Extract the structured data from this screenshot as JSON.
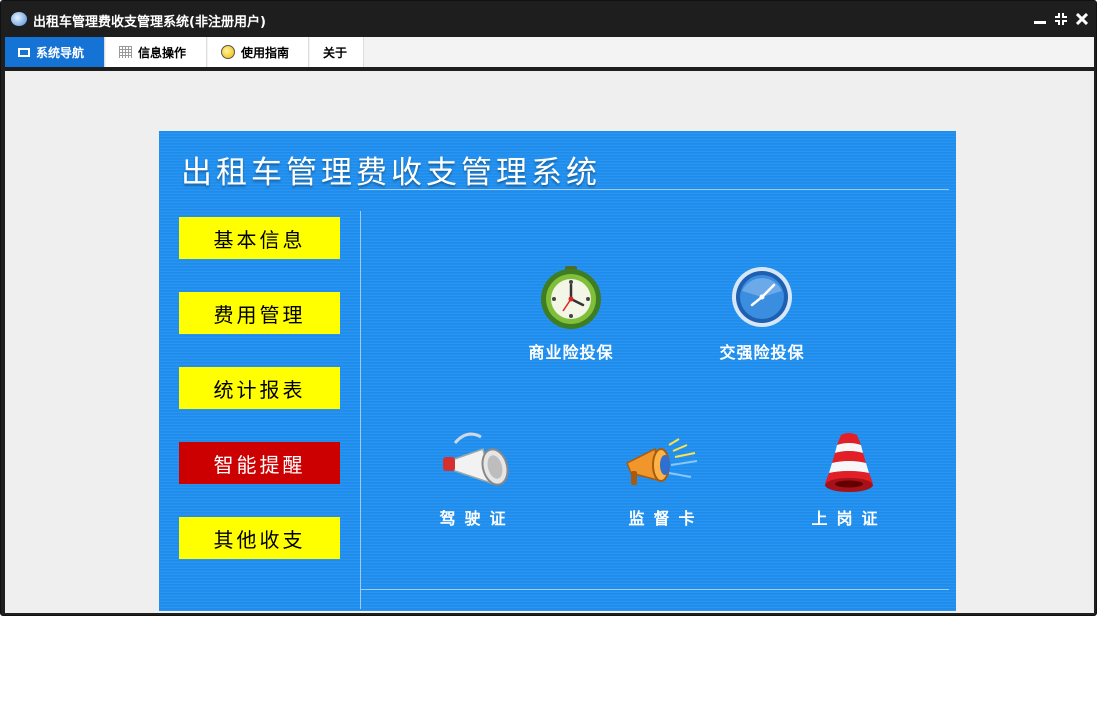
{
  "window": {
    "title": "出租车管理费收支管理系统(非注册用户)",
    "controls": {
      "minimize": "▁",
      "restore": "⇲",
      "close": "✕"
    }
  },
  "menu": {
    "tabs": [
      {
        "label": "系统导航",
        "icon": "monitor-icon",
        "active": true
      },
      {
        "label": "信息操作",
        "icon": "grid-icon",
        "active": false
      },
      {
        "label": "使用指南",
        "icon": "lightbulb-icon",
        "active": false
      },
      {
        "label": "关于",
        "icon": "",
        "active": false
      }
    ]
  },
  "panel": {
    "title": "出租车管理费收支管理系统",
    "sidebar": [
      {
        "label": "基本信息",
        "active": false
      },
      {
        "label": "费用管理",
        "active": false
      },
      {
        "label": "统计报表",
        "active": false
      },
      {
        "label": "智能提醒",
        "active": true
      },
      {
        "label": "其他收支",
        "active": false
      }
    ],
    "features": [
      {
        "label": "商业险投保",
        "icon": "green-clock-icon"
      },
      {
        "label": "交强险投保",
        "icon": "blue-clock-icon"
      },
      {
        "label": "驾驶证",
        "icon": "megaphone-icon"
      },
      {
        "label": "监督卡",
        "icon": "loudspeaker-icon"
      },
      {
        "label": "上岗证",
        "icon": "alarm-bell-icon"
      }
    ]
  },
  "colors": {
    "titlebar": "#1e1e1e",
    "tab_active": "#1573d6",
    "panel_bg": "#1e8ff0",
    "button_default": "#ffff00",
    "button_active": "#cc0000"
  }
}
